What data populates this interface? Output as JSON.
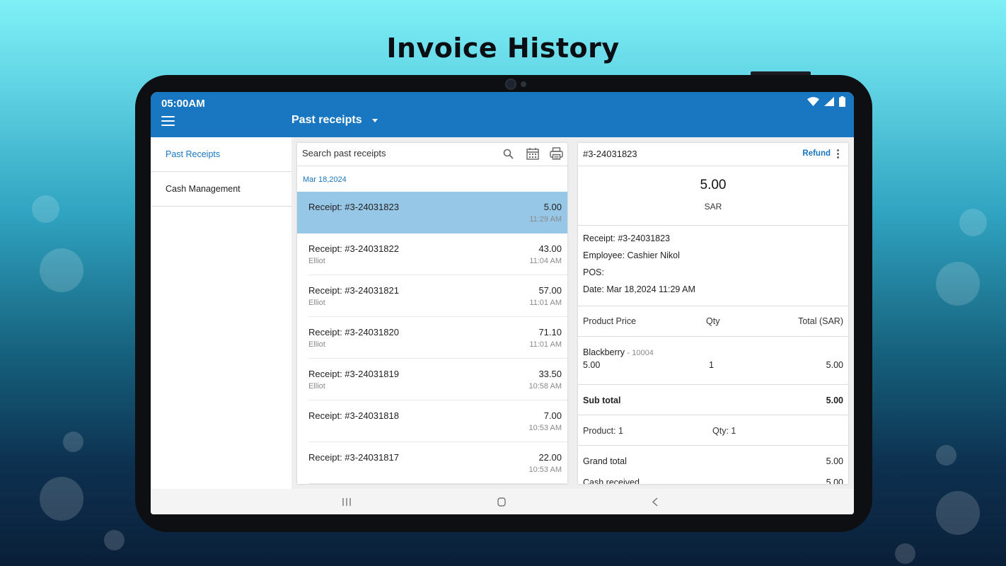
{
  "headline": "Invoice History",
  "status_bar": {
    "time": "05:00AM"
  },
  "app_bar": {
    "title": "Past receipts"
  },
  "sidebar": {
    "items": [
      {
        "label": "Past Receipts",
        "active": true
      },
      {
        "label": "Cash Management",
        "active": false
      }
    ]
  },
  "list": {
    "search_placeholder": "Search past receipts",
    "date_header": "Mar 18,2024",
    "receipts": [
      {
        "title": "Receipt: #3-24031823",
        "employee": "",
        "amount": "5.00",
        "time": "11:29 AM",
        "selected": true
      },
      {
        "title": "Receipt: #3-24031822",
        "employee": "Elliot",
        "amount": "43.00",
        "time": "11:04 AM",
        "selected": false
      },
      {
        "title": "Receipt: #3-24031821",
        "employee": "Elliot",
        "amount": "57.00",
        "time": "11:01 AM",
        "selected": false
      },
      {
        "title": "Receipt: #3-24031820",
        "employee": "Elliot",
        "amount": "71.10",
        "time": "11:01 AM",
        "selected": false
      },
      {
        "title": "Receipt: #3-24031819",
        "employee": "Elliot",
        "amount": "33.50",
        "time": "10:58 AM",
        "selected": false
      },
      {
        "title": "Receipt: #3-24031818",
        "employee": "",
        "amount": "7.00",
        "time": "10:53 AM",
        "selected": false
      },
      {
        "title": "Receipt: #3-24031817",
        "employee": "",
        "amount": "22.00",
        "time": "10:53 AM",
        "selected": false
      }
    ]
  },
  "detail": {
    "number": "#3-24031823",
    "refund_label": "Refund",
    "amount": "5.00",
    "currency": "SAR",
    "info": {
      "receipt": "Receipt: #3-24031823",
      "employee": "Employee: Cashier Nikol",
      "pos": "POS:",
      "date": "Date: Mar 18,2024 11:29 AM"
    },
    "table_header": {
      "product_price": "Product Price",
      "qty": "Qty",
      "total": "Total (SAR)"
    },
    "products": [
      {
        "name": "Blackberry",
        "code": "- 10004",
        "price": "5.00",
        "qty": "1",
        "total": "5.00"
      }
    ],
    "sub_total": {
      "label": "Sub total",
      "value": "5.00"
    },
    "counts": {
      "product": "Product: 1",
      "qty": "Qty: 1"
    },
    "grand_total": {
      "label": "Grand total",
      "value": "5.00"
    },
    "cash_received": {
      "label": "Cash received",
      "value": "5.00"
    }
  },
  "colors": {
    "accent": "#1976c0",
    "selected_row": "#97c7e6"
  }
}
